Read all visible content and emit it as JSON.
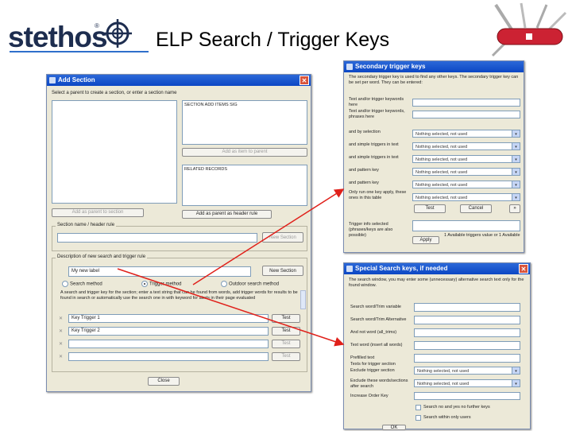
{
  "header": {
    "logo_text": "stethos",
    "logo_mark": "®",
    "slide_title": "ELP Search / Trigger Keys"
  },
  "add_section": {
    "title": "Add Section",
    "instruction": "Select a parent to create a section, or enter a section name",
    "right_box1_text": "SECTION ADD ITEMS SIG",
    "right_box2_text": "RELATED RECORDS",
    "btn_add_as_item": "Add as item to parent",
    "btn_add_parent_section": "Add as parent to section",
    "btn_add_parent_header": "Add as parent as header rule",
    "section_name_label": "Section name / header rule",
    "btn_new_section_disabled": "New Section",
    "trigger_group_label": "Description of new search and trigger rule",
    "new_label_value": "My new label",
    "btn_new_section": "New Section",
    "radio_search": "Search method",
    "radio_trigger": "Trigger method",
    "radio_outdoor": "Outdoor search method",
    "note_text": "A search and trigger key for the section; enter a text string that can be found from words, add trigger words for results to be found in search or automatically use the search one in with keyword for alerts in their page evaluated",
    "trigger_rows": [
      {
        "value": "Key Trigger 1",
        "button": "Test"
      },
      {
        "value": "Key Trigger 2",
        "button": "Test"
      },
      {
        "value": "",
        "button": "Test"
      },
      {
        "value": "",
        "button": "Test"
      }
    ],
    "btn_close": "Close"
  },
  "secondary_trigger": {
    "title": "Secondary trigger keys",
    "intro": "The secondary trigger key is used to find any other keys. The secondary trigger key can be set per word. They can be entered:",
    "rows": [
      {
        "label": "Text and/or trigger keywords here",
        "type": "text",
        "value": ""
      },
      {
        "label": "Text and/or trigger keywords, phrases here",
        "type": "text",
        "value": ""
      },
      {
        "label": "and by selection",
        "type": "select",
        "value": "Nothing selected, not used"
      },
      {
        "label": "and simple triggers in text",
        "type": "select",
        "value": "Nothing selected, not used"
      },
      {
        "label": "and simple triggers in text",
        "type": "select",
        "value": "Nothing selected, not used"
      },
      {
        "label": "and pattern key",
        "type": "select",
        "value": "Nothing selected, not used"
      },
      {
        "label": "and pattern key",
        "type": "select",
        "value": "Nothing selected, not used"
      },
      {
        "label": "Only run one key apply, these ones in this table",
        "type": "select",
        "value": "Nothing selected, not used"
      }
    ],
    "btn_test": "Test",
    "btn_cancel": "Cancel",
    "trigger_info_label": "Trigger info selected (phrases/keys are also possible)",
    "btn_apply": "Apply",
    "status_text": "1 Available triggers value or 1 Available"
  },
  "special_search": {
    "title": "Special Search keys, if needed",
    "intro": "The search window, you may enter some (unnecessary) alternative search text only for the found window.",
    "rows": [
      {
        "label": "Search word/Trim variable",
        "type": "text",
        "value": ""
      },
      {
        "label": "Search word/Trim Alternative",
        "type": "text",
        "value": ""
      },
      {
        "label": "And not word (all_trims)",
        "type": "text",
        "value": ""
      },
      {
        "label": "Text word (insert all words)",
        "type": "text",
        "value": ""
      },
      {
        "label": "Prefilled text",
        "type": "text",
        "value": ""
      },
      {
        "label": "Texts for trigger section",
        "type": "text",
        "value": ""
      },
      {
        "label": "Exclude trigger section",
        "type": "select",
        "value": "Nothing selected, not used"
      },
      {
        "label": "Exclude these words/sections after search",
        "type": "select",
        "value": "Nothing selected, not used"
      },
      {
        "label": "Increase Order Key",
        "type": "text",
        "value": ""
      }
    ],
    "check1": "Search no and yes no further keys",
    "check2": "Search within only users",
    "btn_ok": "OK"
  },
  "colors": {
    "titlebar": "#0c47c4",
    "window_bg": "#ece9d8",
    "arrow": "#e0201a",
    "logo": "#1d2d4f"
  },
  "icons": [
    "stethos-crosshair-logo-icon",
    "swiss-army-knife-icon",
    "window-app-icon",
    "close-icon",
    "dropdown-arrow-icon"
  ]
}
